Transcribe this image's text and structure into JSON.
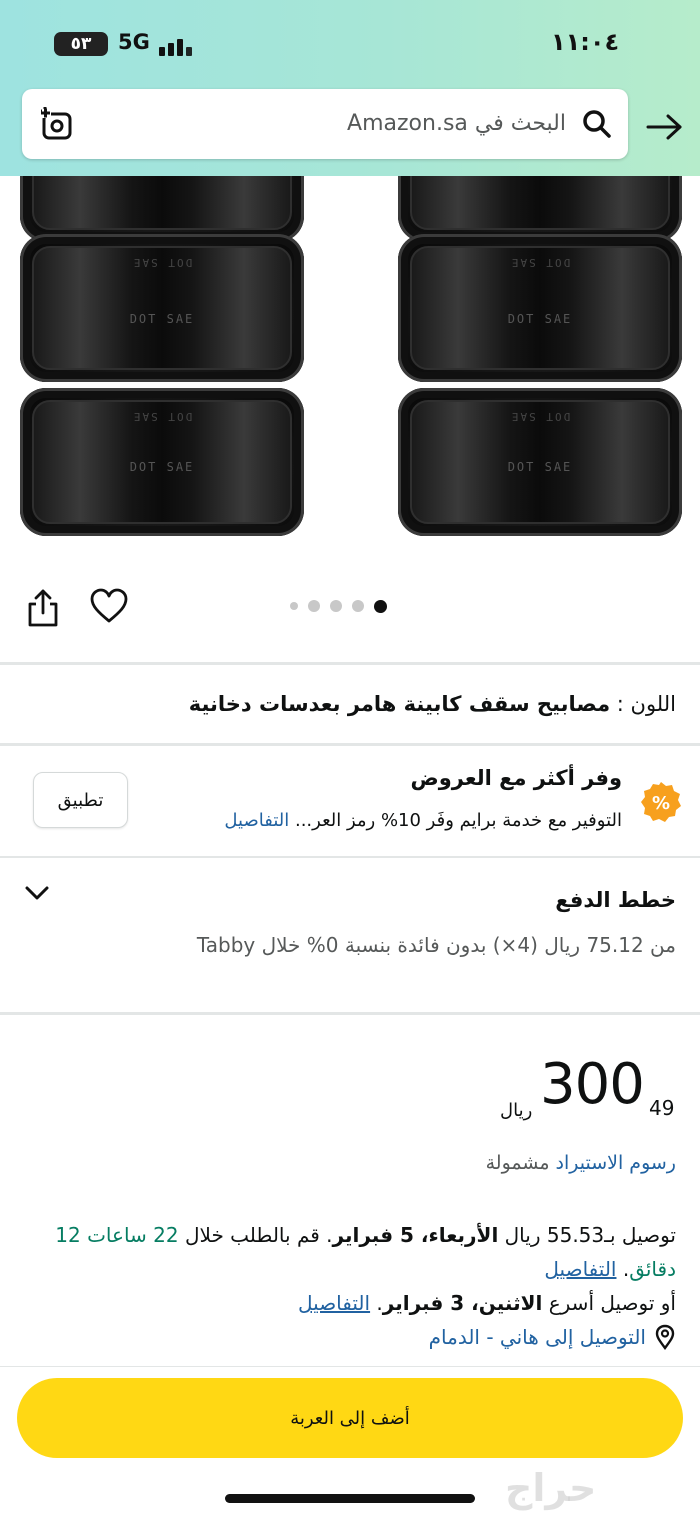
{
  "status_bar": {
    "time": "١١:٠٤",
    "battery": "٥٣",
    "network": "5G"
  },
  "search": {
    "placeholder": "البحث في Amazon.sa"
  },
  "product_image": {
    "lamp_text_primary": "DOT SAE",
    "lamp_text_secondary": "DOT SAE",
    "carousel_total": 5,
    "carousel_active": 5
  },
  "color": {
    "label": "اللون :",
    "value": "مصابيح سقف كابينة هامر بعدسات دخانية"
  },
  "offers": {
    "title": "وفر أكثر مع العروض",
    "description": "التوفير مع خدمة برايم وفَر 10% رمز العر...",
    "details_link": "التفاصيل",
    "apply_button": "تطبيق"
  },
  "payment_plans": {
    "title": "خطط الدفع",
    "description": "من 75.12 ريال (4×) بدون فائدة بنسبة 0% خلال Tabby"
  },
  "price": {
    "whole": "300",
    "fraction": "49",
    "currency": "ريال",
    "import_fees_link": "رسوم الاستيراد",
    "import_fees_text": "مشمولة"
  },
  "delivery": {
    "line1_prefix": "توصيل بـ55.53 ريال ",
    "line1_date": "الأربعاء، 5 فبراير",
    "line1_mid": ". قم بالطلب خلال ",
    "line1_countdown": "22 ساعات 12 دقائق",
    "line1_suffix": ". ",
    "details_link": "التفاصيل",
    "line2_prefix": "أو توصيل أسرع ",
    "line2_date": "الاثنين، 3 فبراير",
    "line2_suffix": ". ",
    "details_link2": "التفاصيل",
    "deliver_to": "التوصيل إلى هاني - الدمام"
  },
  "add_to_cart": "أضف إلى العربة",
  "watermark": "حراج",
  "colors": {
    "header_start": "#9ee3e0",
    "header_end": "#b6eccb",
    "cart_button": "#ffd814",
    "link": "#2162a1",
    "green": "#067d62",
    "badge": "#f7a01e"
  }
}
